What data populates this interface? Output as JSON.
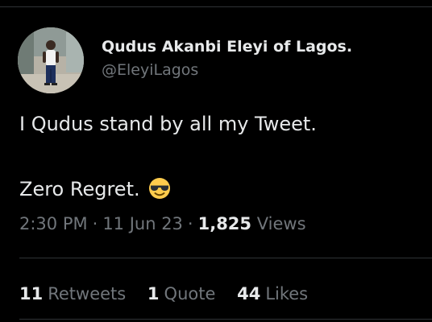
{
  "author": {
    "name": "Qudus Akanbi Eleyi of Lagos.",
    "handle": "@EleyiLagos"
  },
  "tweet": {
    "line1": "I Qudus stand by all my Tweet.",
    "line2": "Zero Regret.",
    "emoji": "smiling-face-with-sunglasses-icon"
  },
  "meta": {
    "time": "2:30 PM",
    "separator": "·",
    "date": "11 Jun 23",
    "views_count": "1,825",
    "views_label": "Views"
  },
  "stats": {
    "retweets_count": "11",
    "retweets_label": "Retweets",
    "quotes_count": "1",
    "quotes_label": "Quote",
    "likes_count": "44",
    "likes_label": "Likes"
  },
  "colors": {
    "background": "#000000",
    "primary_text": "#e7e9ea",
    "secondary_text": "#71767b",
    "divider": "#2f3336"
  }
}
